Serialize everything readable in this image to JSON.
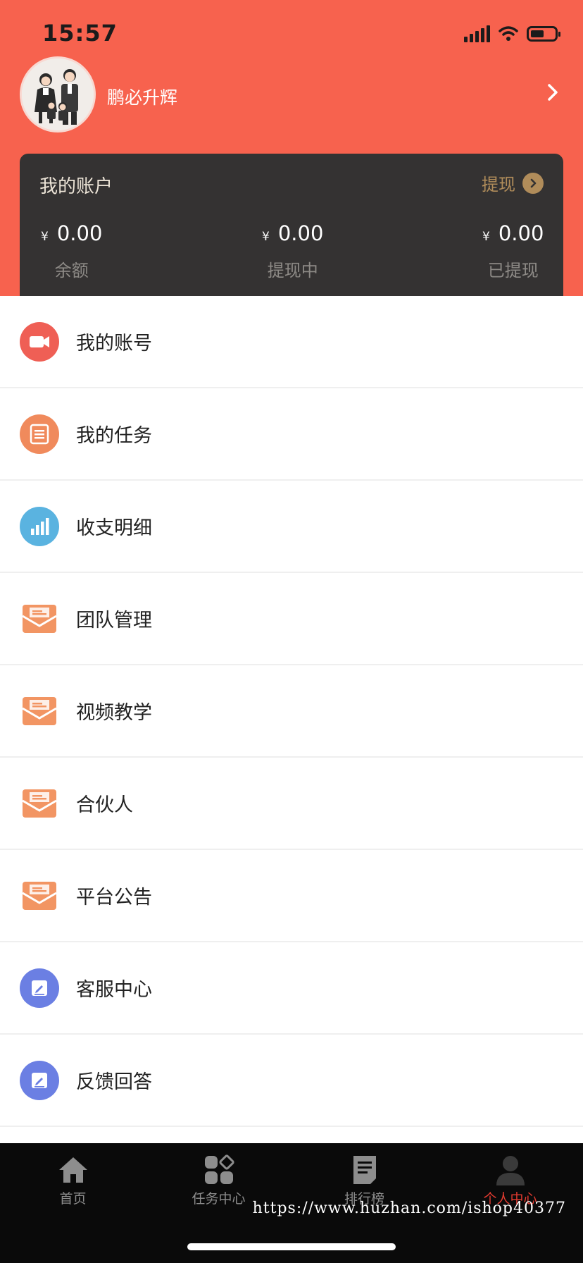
{
  "status_bar": {
    "time": "15:57"
  },
  "profile": {
    "username": "鹏必升辉"
  },
  "account": {
    "title": "我的账户",
    "withdraw_label": "提现",
    "stats": [
      {
        "currency": "¥",
        "value": "0.00",
        "label": "余额"
      },
      {
        "currency": "¥",
        "value": "0.00",
        "label": "提现中"
      },
      {
        "currency": "¥",
        "value": "0.00",
        "label": "已提现"
      }
    ]
  },
  "menu": {
    "items": [
      {
        "label": "我的账号",
        "icon": "video-camera-icon",
        "color": "#ef5f55"
      },
      {
        "label": "我的任务",
        "icon": "task-list-icon",
        "color": "#f08a5c"
      },
      {
        "label": "收支明细",
        "icon": "bar-chart-icon",
        "color": "#5ab3e0"
      },
      {
        "label": "团队管理",
        "icon": "envelope-icon",
        "color": "#f29563"
      },
      {
        "label": "视频教学",
        "icon": "envelope-icon",
        "color": "#f29563"
      },
      {
        "label": "合伙人",
        "icon": "envelope-icon",
        "color": "#f29563"
      },
      {
        "label": "平台公告",
        "icon": "envelope-icon",
        "color": "#f29563"
      },
      {
        "label": "客服中心",
        "icon": "edit-icon",
        "color": "#6b7fe3"
      },
      {
        "label": "反馈回答",
        "icon": "edit-icon",
        "color": "#6b7fe3"
      }
    ]
  },
  "tabbar": {
    "tabs": [
      {
        "label": "首页",
        "icon": "home-icon"
      },
      {
        "label": "任务中心",
        "icon": "grid-icon"
      },
      {
        "label": "排行榜",
        "icon": "document-icon"
      },
      {
        "label": "个人中心",
        "icon": "person-icon",
        "active": true
      }
    ],
    "watermark": "https://www.huzhan.com/ishop40377"
  },
  "colors": {
    "header_bg": "#f7624e",
    "card_bg": "#343232",
    "withdraw_gold": "#b08c5a",
    "active_tab": "#e03a2f"
  }
}
